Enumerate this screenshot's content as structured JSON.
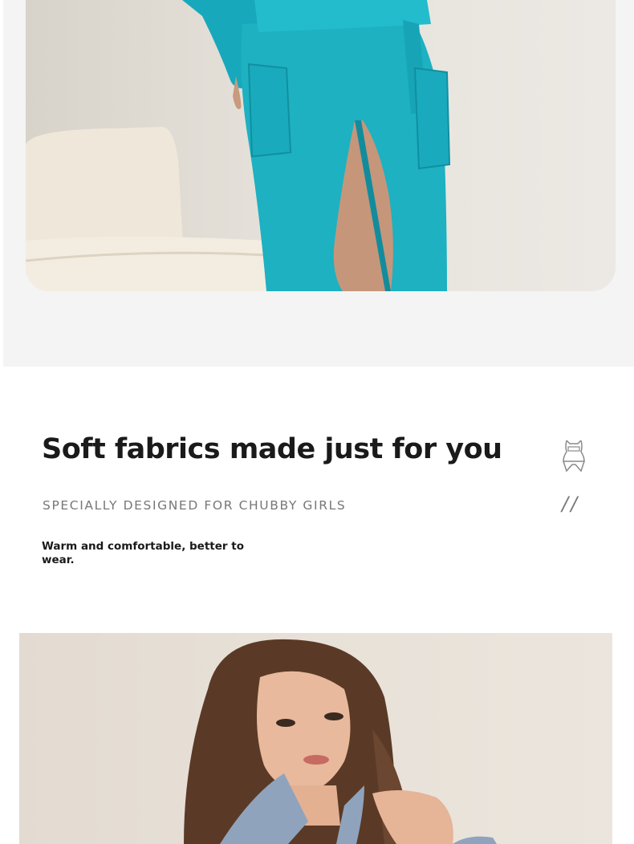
{
  "section": {
    "heading": "Soft fabrics made just for you",
    "subheading": "SPECIALLY DESIGNED FOR CHUBBY GIRLS",
    "description": "Warm and comfortable, better to wear.",
    "decoration": "//",
    "icon": "body-shape-icon"
  },
  "colors": {
    "robe_teal": "#1fb3c4",
    "robe_blue_grey": "#8fa3bd",
    "panel_bg": "#f4f4f4",
    "heading": "#1a1a1a",
    "subheading": "#777777"
  }
}
